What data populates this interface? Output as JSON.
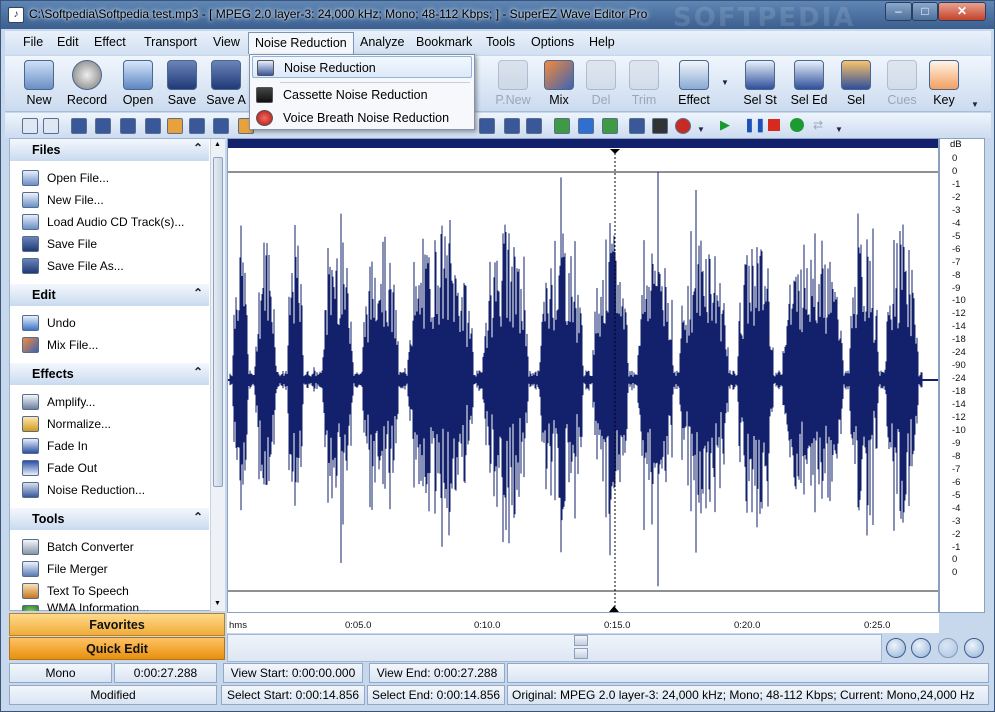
{
  "window": {
    "title": "C:\\Softpedia\\Softpedia test.mp3 - [ MPEG 2.0 layer-3: 24,000 kHz; Mono; 48-112 Kbps;  ] - SuperEZ Wave Editor Pro",
    "watermark": "SOFTPEDIA"
  },
  "menu": {
    "items": [
      "File",
      "Edit",
      "Effect",
      "Transport",
      "View",
      "Noise Reduction",
      "Analyze",
      "Bookmark",
      "Tools",
      "Options",
      "Help"
    ],
    "active": "Noise Reduction"
  },
  "dropdown": {
    "items": [
      "Noise Reduction",
      "Cassette Noise Reduction",
      "Voice Breath Noise Reduction"
    ]
  },
  "toolbar": {
    "buttons": [
      {
        "label": "New",
        "icon": "new-file-icon",
        "enabled": true
      },
      {
        "label": "Record",
        "icon": "microphone-icon",
        "enabled": true
      },
      {
        "label": "Open",
        "icon": "open-folder-icon",
        "enabled": true
      },
      {
        "label": "Save",
        "icon": "floppy-icon",
        "enabled": true
      },
      {
        "label": "Save A",
        "icon": "save-as-icon",
        "enabled": true
      },
      {
        "label": "P.New",
        "icon": "paste-new-icon",
        "enabled": false
      },
      {
        "label": "Mix",
        "icon": "mix-icon",
        "enabled": true
      },
      {
        "label": "Del",
        "icon": "delete-icon",
        "enabled": false
      },
      {
        "label": "Trim",
        "icon": "trim-icon",
        "enabled": false
      },
      {
        "label": "Effect",
        "icon": "effect-icon",
        "enabled": true
      },
      {
        "label": "Sel St",
        "icon": "select-start-icon",
        "enabled": true
      },
      {
        "label": "Sel Ed",
        "icon": "select-end-icon",
        "enabled": true
      },
      {
        "label": "Sel",
        "icon": "select-icon",
        "enabled": true
      },
      {
        "label": "Cues",
        "icon": "cues-icon",
        "enabled": false
      },
      {
        "label": "Key",
        "icon": "key-icon",
        "enabled": true
      }
    ]
  },
  "sidebar": {
    "sections": [
      {
        "title": "Files",
        "items": [
          "Open File...",
          "New File...",
          "Load Audio CD Track(s)...",
          "Save File",
          "Save File As..."
        ]
      },
      {
        "title": "Edit",
        "items": [
          "Undo",
          "Mix File..."
        ]
      },
      {
        "title": "Effects",
        "items": [
          "Amplify...",
          "Normalize...",
          "Fade In",
          "Fade Out",
          "Noise Reduction..."
        ]
      },
      {
        "title": "Tools",
        "items": [
          "Batch Converter",
          "File Merger",
          "Text To Speech",
          "WMA Information..."
        ]
      }
    ],
    "favorites": "Favorites",
    "quick_edit": "Quick Edit"
  },
  "wave": {
    "db_unit": "dB",
    "db_labels": [
      "0",
      "0",
      "-1",
      "-2",
      "-3",
      "-4",
      "-5",
      "-6",
      "-7",
      "-8",
      "-9",
      "-10",
      "-12",
      "-14",
      "-18",
      "-24",
      "-90",
      "-24",
      "-18",
      "-14",
      "-12",
      "-10",
      "-9",
      "-8",
      "-7",
      "-6",
      "-5",
      "-4",
      "-3",
      "-2",
      "-1",
      "0",
      "0"
    ],
    "time_labels": [
      "hms",
      "0:05.0",
      "0:10.0",
      "0:15.0",
      "0:20.0",
      "0:25.0"
    ],
    "color": "#13206b"
  },
  "status": {
    "channels": "Mono",
    "length": "0:00:27.288",
    "view_start": "View Start: 0:00:00.000",
    "view_end": "View End: 0:00:27.288",
    "state": "Modified",
    "select_start": "Select Start: 0:00:14.856",
    "select_end": "Select End: 0:00:14.856",
    "original": "Original: MPEG 2.0 layer-3: 24,000 kHz; Mono; 48-112 Kbps;  Current: Mono,24,000 Hz"
  }
}
